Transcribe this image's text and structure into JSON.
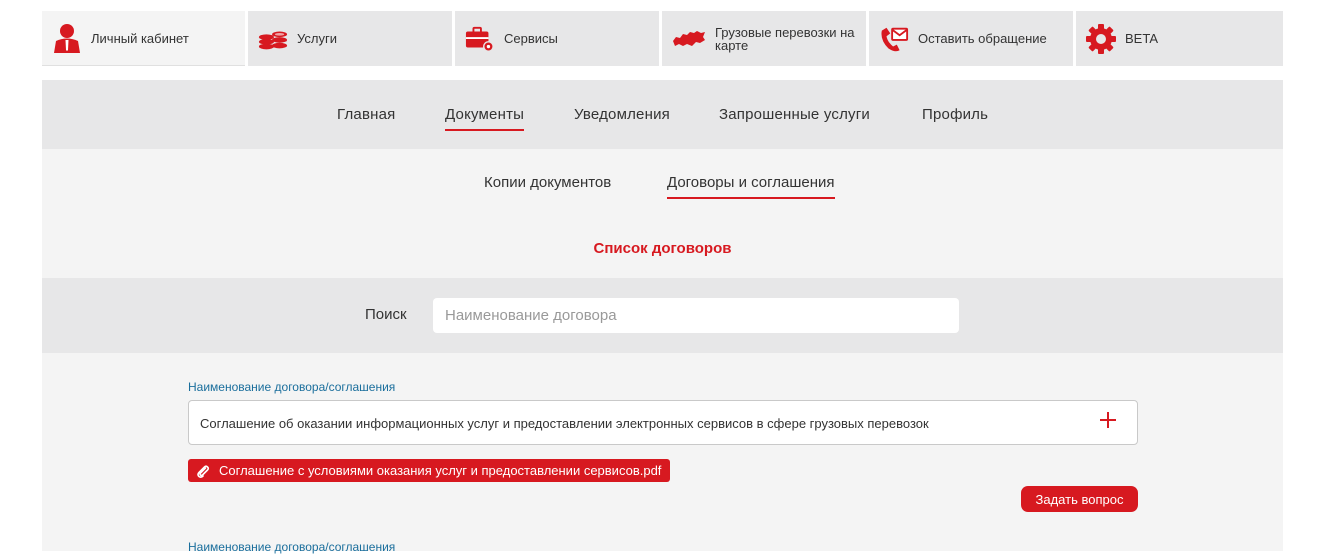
{
  "colors": {
    "accent": "#d71920",
    "link": "#1a6e9c",
    "nav_bg": "#e7e7e8",
    "content_bg": "#f4f4f4"
  },
  "topbar": {
    "items": [
      {
        "label": "Личный кабинет",
        "icon": "user-icon"
      },
      {
        "label": "Услуги",
        "icon": "coins-icon"
      },
      {
        "label": "Сервисы",
        "icon": "toolbox-icon"
      },
      {
        "label": "Грузовые перевозки на карте",
        "icon": "map-icon"
      },
      {
        "label": "Оставить обращение",
        "icon": "phone-mail-icon"
      },
      {
        "label": "BETA",
        "icon": "gear-icon"
      }
    ]
  },
  "main_nav": {
    "tabs": [
      "Главная",
      "Документы",
      "Уведомления",
      "Запрошенные услуги",
      "Профиль"
    ],
    "active": "Документы"
  },
  "sub_nav": {
    "tabs": [
      "Копии документов",
      "Договоры и соглашения"
    ],
    "active": "Договоры и соглашения"
  },
  "list_title": "Список договоров",
  "search": {
    "label": "Поиск",
    "placeholder": "Наименование договора",
    "value": ""
  },
  "contracts": [
    {
      "field_label": "Наименование договора/соглашения",
      "name": "Соглашение об оказании информационных услуг и предоставлении электронных сервисов в сфере грузовых перевозок",
      "attachment": "Соглашение с условиями оказания услуг и предоставлении сервисов.pdf",
      "ask_button": "Задать вопрос"
    },
    {
      "field_label": "Наименование договора/соглашения"
    }
  ]
}
